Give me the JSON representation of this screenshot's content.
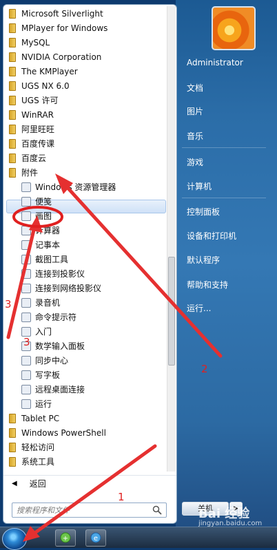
{
  "programs": [
    {
      "label": "Microsoft Silverlight",
      "type": "folder"
    },
    {
      "label": "MPlayer for Windows",
      "type": "folder"
    },
    {
      "label": "MySQL",
      "type": "folder"
    },
    {
      "label": "NVIDIA Corporation",
      "type": "folder"
    },
    {
      "label": "The KMPlayer",
      "type": "folder"
    },
    {
      "label": "UGS NX 6.0",
      "type": "folder"
    },
    {
      "label": "UGS 许可",
      "type": "folder"
    },
    {
      "label": "WinRAR",
      "type": "folder"
    },
    {
      "label": "阿里旺旺",
      "type": "folder"
    },
    {
      "label": "百度传课",
      "type": "folder"
    },
    {
      "label": "百度云",
      "type": "folder"
    },
    {
      "label": "附件",
      "type": "folder"
    },
    {
      "label": "Windows 资源管理器",
      "type": "app",
      "icon": "explorer-icon"
    },
    {
      "label": "便笺",
      "type": "app",
      "icon": "sticky-notes-icon"
    },
    {
      "label": "画图",
      "type": "app",
      "icon": "paint-icon"
    },
    {
      "label": "计算器",
      "type": "app",
      "icon": "calculator-icon"
    },
    {
      "label": "记事本",
      "type": "app",
      "icon": "notepad-icon"
    },
    {
      "label": "截图工具",
      "type": "app",
      "icon": "snipping-tool-icon"
    },
    {
      "label": "连接到投影仪",
      "type": "app",
      "icon": "projector-icon"
    },
    {
      "label": "连接到网络投影仪",
      "type": "app",
      "icon": "network-projector-icon"
    },
    {
      "label": "录音机",
      "type": "app",
      "icon": "microphone-icon"
    },
    {
      "label": "命令提示符",
      "type": "app",
      "icon": "cmd-icon"
    },
    {
      "label": "入门",
      "type": "app",
      "icon": "getting-started-icon"
    },
    {
      "label": "数学输入面板",
      "type": "app",
      "icon": "math-input-icon"
    },
    {
      "label": "同步中心",
      "type": "app",
      "icon": "sync-center-icon"
    },
    {
      "label": "写字板",
      "type": "app",
      "icon": "wordpad-icon"
    },
    {
      "label": "远程桌面连接",
      "type": "app",
      "icon": "remote-desktop-icon"
    },
    {
      "label": "运行",
      "type": "app",
      "icon": "run-icon"
    },
    {
      "label": "Tablet PC",
      "type": "folder"
    },
    {
      "label": "Windows PowerShell",
      "type": "folder"
    },
    {
      "label": "轻松访问",
      "type": "folder"
    },
    {
      "label": "系统工具",
      "type": "folder"
    }
  ],
  "back_label": "返回",
  "search": {
    "placeholder": "搜索程序和文件"
  },
  "right_panel": {
    "user": "Administrator",
    "items": [
      "文档",
      "图片",
      "音乐",
      "游戏",
      "计算机",
      "控制面板",
      "设备和打印机",
      "默认程序",
      "帮助和支持",
      "运行..."
    ]
  },
  "shutdown_label": "关机",
  "annotations": [
    "1",
    "2",
    "3",
    "3"
  ],
  "watermark": {
    "main": "Bai 经验",
    "sub": "jingyan.baidu.com"
  },
  "colors": {
    "annotation": "#e02020",
    "right_panel": "#2b6da8",
    "highlight": "#cfe1f7"
  }
}
